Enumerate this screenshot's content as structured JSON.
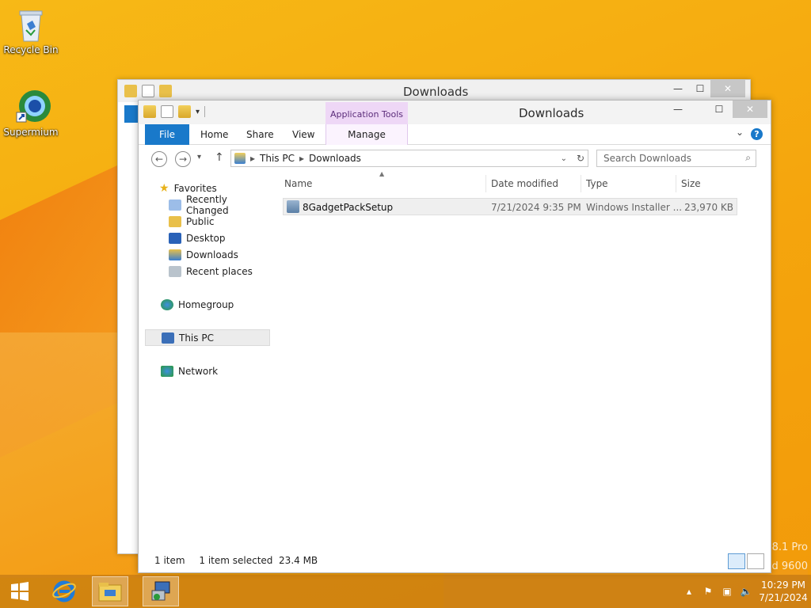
{
  "desktop": {
    "icons": [
      {
        "label": "Recycle Bin",
        "icon": "recycle-bin-icon"
      },
      {
        "label": "Supermium",
        "icon": "supermium-icon"
      }
    ],
    "watermark_line1": "8.1 Pro",
    "watermark_line2": "d 9600"
  },
  "back_window": {
    "title": "Downloads"
  },
  "window": {
    "title": "Downloads",
    "minimize": "—",
    "maximize": "☐",
    "close": "✕",
    "contextual_group": "Application Tools",
    "ribbon": {
      "tabs": [
        "File",
        "Home",
        "Share",
        "View"
      ],
      "contextual_tab": "Manage"
    },
    "address": {
      "segments": [
        "This PC",
        "Downloads"
      ]
    },
    "search_placeholder": "Search Downloads",
    "nav_pane": {
      "favorites_header": "Favorites",
      "favorites": [
        "Recently Changed",
        "Public",
        "Desktop",
        "Downloads",
        "Recent places"
      ],
      "homegroup": "Homegroup",
      "this_pc": "This PC",
      "network": "Network"
    },
    "columns": [
      "Name",
      "Date modified",
      "Type",
      "Size"
    ],
    "files": [
      {
        "name": "8GadgetPackSetup",
        "date": "7/21/2024 9:35 PM",
        "type": "Windows Installer ...",
        "size": "23,970 KB"
      }
    ],
    "status": {
      "count": "1 item",
      "selection": "1 item selected  23.4 MB"
    }
  },
  "taskbar": {
    "clock_time": "10:29 PM",
    "clock_date": "7/21/2024"
  },
  "colors": {
    "accent": "#1979ca",
    "wallpaper": "#f5a50d",
    "contextual": "#eed7f6"
  }
}
